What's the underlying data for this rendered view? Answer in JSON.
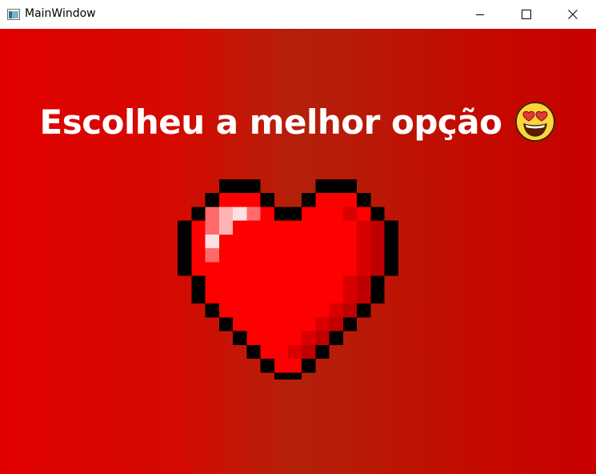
{
  "window": {
    "title": "MainWindow",
    "icon": "app-window-icon",
    "controls": [
      "minimize-icon",
      "maximize-icon",
      "close-icon"
    ]
  },
  "content": {
    "headline": "Escolheu a melhor opção",
    "emoji": "heart-eyes-grinning-face-icon",
    "illustration": "pixel-heart-icon"
  },
  "colors": {
    "background_left": "#e00000",
    "background_mid": "#b3210b",
    "background_right": "#c80000",
    "heart": "#ff0000",
    "outline": "#000000",
    "text": "#ffffff"
  }
}
